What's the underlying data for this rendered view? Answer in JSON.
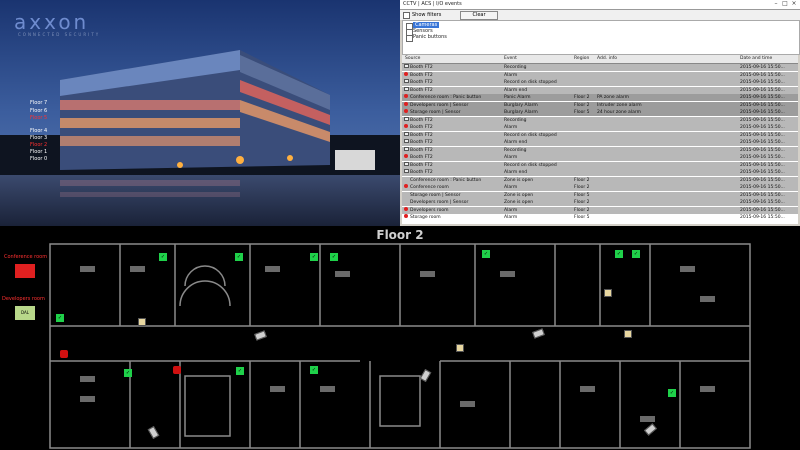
{
  "photo": {
    "logo": "axxon",
    "tagline": "CONNECTED SECURITY",
    "floors": [
      {
        "label": "Floor 7",
        "alarm": false
      },
      {
        "label": "Floor 6",
        "alarm": false
      },
      {
        "label": "Floor 5",
        "alarm": true
      },
      {
        "label": "Floor 4",
        "alarm": false
      },
      {
        "label": "Floor 3",
        "alarm": false
      },
      {
        "label": "Floor 2",
        "alarm": true
      },
      {
        "label": "Floor 1",
        "alarm": false
      },
      {
        "label": "Floor 0",
        "alarm": false
      }
    ]
  },
  "events_window": {
    "title": "CCTV | ACS | I/O events",
    "show_filters_label": "Show filters",
    "clear_label": "Clear",
    "filters": [
      "Cameras",
      "Sensors",
      "Panic buttons"
    ],
    "columns": [
      "Source",
      "Event",
      "Region",
      "Add. info",
      "Date and time"
    ],
    "rows": [
      {
        "source": "Booth FT2",
        "event": "Recording",
        "region": "",
        "info": "",
        "time": "2015-09-16 15:50...",
        "status": "cam",
        "bg": "#b8b8b8"
      },
      {
        "source": "Booth FT2",
        "event": "Alarm",
        "region": "",
        "info": "",
        "time": "2015-09-16 15:50...",
        "status": "alarm",
        "bg": "#b8b8b8"
      },
      {
        "source": "Booth FT2",
        "event": "Record on disk stopped",
        "region": "",
        "info": "",
        "time": "2015-09-16 15:50...",
        "status": "cam",
        "bg": "#b8b8b8"
      },
      {
        "source": "Booth FT2",
        "event": "Alarm end",
        "region": "",
        "info": "",
        "time": "2015-09-16 15:50...",
        "status": "cam",
        "bg": "#b8b8b8"
      },
      {
        "source": "Conference room : Panic button",
        "event": "Panic Alarm",
        "region": "Floor 2",
        "info": "PA zone alarm",
        "time": "2015-09-16 15:50...",
        "status": "alarm",
        "bg": "#9c9c9c"
      },
      {
        "source": "Developers room | Sensor",
        "event": "Burglary Alarm",
        "region": "Floor 2",
        "info": "Intruder zone alarm",
        "time": "2015-09-16 15:50...",
        "status": "alarm",
        "bg": "#9c9c9c"
      },
      {
        "source": "Storage room | Sensor",
        "event": "Burglary Alarm",
        "region": "Floor 5",
        "info": "24 hour zone alarm",
        "time": "2015-09-16 15:50...",
        "status": "alarm",
        "bg": "#9c9c9c"
      },
      {
        "source": "Booth FT2",
        "event": "Recording",
        "region": "",
        "info": "",
        "time": "2015-09-16 15:50...",
        "status": "cam",
        "bg": "#b8b8b8"
      },
      {
        "source": "Booth FT2",
        "event": "Alarm",
        "region": "",
        "info": "",
        "time": "2015-09-16 15:50...",
        "status": "alarm",
        "bg": "#b8b8b8"
      },
      {
        "source": "Booth FT2",
        "event": "Record on disk stopped",
        "region": "",
        "info": "",
        "time": "2015-09-16 15:50...",
        "status": "cam",
        "bg": "#b8b8b8"
      },
      {
        "source": "Booth FT2",
        "event": "Alarm end",
        "region": "",
        "info": "",
        "time": "2015-09-16 15:50...",
        "status": "cam",
        "bg": "#b8b8b8"
      },
      {
        "source": "Booth FT2",
        "event": "Recording",
        "region": "",
        "info": "",
        "time": "2015-09-16 15:50...",
        "status": "cam",
        "bg": "#b8b8b8"
      },
      {
        "source": "Booth FT2",
        "event": "Alarm",
        "region": "",
        "info": "",
        "time": "2015-09-16 15:50...",
        "status": "alarm",
        "bg": "#b8b8b8"
      },
      {
        "source": "Booth FT2",
        "event": "Record on disk stopped",
        "region": "",
        "info": "",
        "time": "2015-09-16 15:50...",
        "status": "cam",
        "bg": "#b8b8b8"
      },
      {
        "source": "Booth FT2",
        "event": "Alarm end",
        "region": "",
        "info": "",
        "time": "2015-09-16 15:50...",
        "status": "cam",
        "bg": "#b8b8b8"
      },
      {
        "source": "Conference room : Panic button",
        "event": "Zone is open",
        "region": "Floor 2",
        "info": "",
        "time": "2015-09-16 15:50...",
        "status": "none",
        "bg": "#b8b8b8"
      },
      {
        "source": "Conference room",
        "event": "Alarm",
        "region": "Floor 2",
        "info": "",
        "time": "2015-09-16 15:50...",
        "status": "alarm",
        "bg": "#b8b8b8"
      },
      {
        "source": "Storage room | Sensor",
        "event": "Zone is open",
        "region": "Floor 5",
        "info": "",
        "time": "2015-09-16 15:50...",
        "status": "none",
        "bg": "#b8b8b8"
      },
      {
        "source": "Developers room | Sensor",
        "event": "Zone is open",
        "region": "Floor 2",
        "info": "",
        "time": "2015-09-16 15:50...",
        "status": "none",
        "bg": "#b8b8b8"
      },
      {
        "source": "Developers room",
        "event": "Alarm",
        "region": "Floor 2",
        "info": "",
        "time": "2015-09-16 15:50...",
        "status": "alarm",
        "bg": "#b8b8b8"
      },
      {
        "source": "Storage room",
        "event": "Alarm",
        "region": "Floor 5",
        "info": "",
        "time": "2015-09-16 15:50...",
        "status": "alarm",
        "bg": "#ffffff"
      }
    ]
  },
  "floor_plan": {
    "title": "Floor 2",
    "conference_label": "Conference room",
    "conference_btn": "",
    "developers_label": "Developers room",
    "developers_btn": "DAL"
  },
  "colors": {
    "alarm": "#e02020",
    "sensor": "#1fd14a",
    "accent": "#3875d7"
  }
}
